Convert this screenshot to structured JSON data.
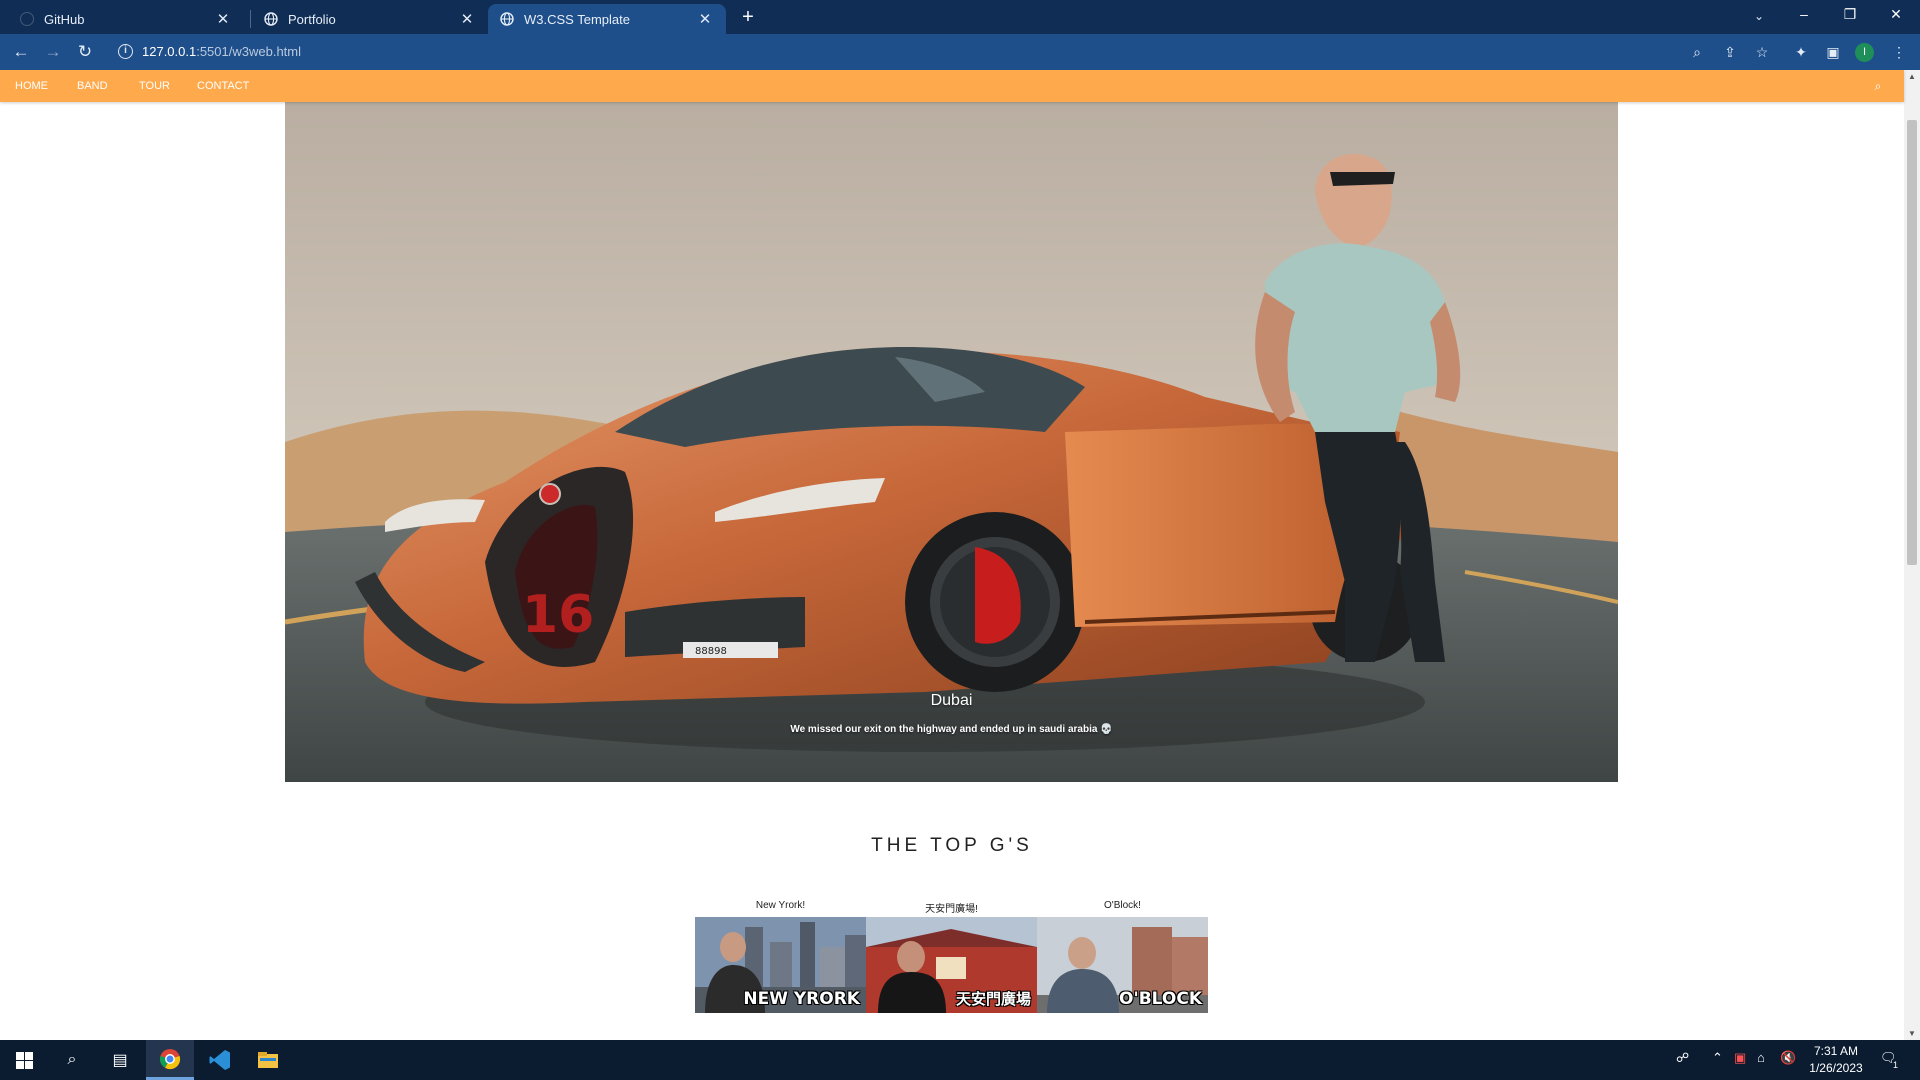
{
  "browser": {
    "tabs": [
      {
        "title": "GitHub",
        "icon": "github-icon"
      },
      {
        "title": "Portfolio",
        "icon": "globe-icon"
      },
      {
        "title": "W3.CSS Template",
        "icon": "globe-icon",
        "active": true
      }
    ],
    "url_host": "127.0.0.1",
    "url_rest": ":5501/w3web.html"
  },
  "nav": {
    "links": [
      "HOME",
      "BAND",
      "TOUR",
      "CONTACT"
    ]
  },
  "hero": {
    "caption_title": "Dubai",
    "caption_text": "We missed our exit on the highway and ended up in saudi arabia 💀",
    "car_plate_number": "16"
  },
  "band": {
    "title": "THE TOP G'S",
    "members": [
      {
        "name": "New Yrork!",
        "image_text": "NEW YRORK"
      },
      {
        "name": "天安門廣場!",
        "image_text": "天安門廣場"
      },
      {
        "name": "O'Block!",
        "image_text": "O'BLOCK"
      }
    ]
  },
  "taskbar": {
    "time": "7:31 AM",
    "date": "1/26/2023",
    "notifications": "1"
  },
  "colors": {
    "nav_bar": "#ffa94d",
    "tab_strip": "#0f2d55",
    "toolbar": "#1e4f8a",
    "taskbar": "#0b1c31"
  }
}
